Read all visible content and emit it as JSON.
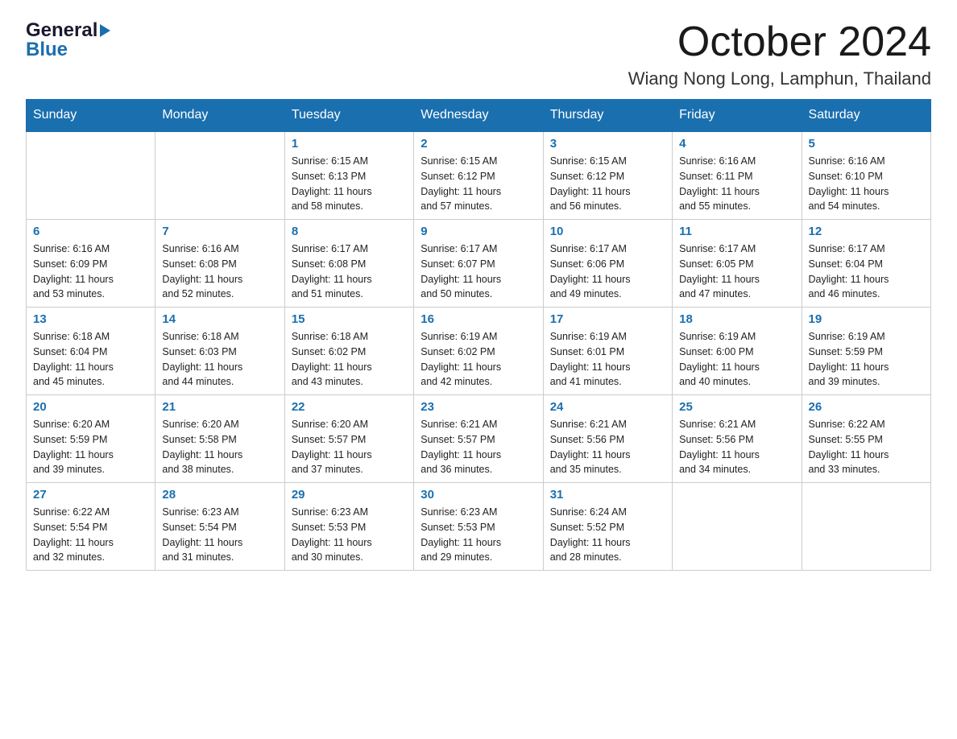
{
  "logo": {
    "line1": "General",
    "line2": "Blue"
  },
  "header": {
    "month": "October 2024",
    "location": "Wiang Nong Long, Lamphun, Thailand"
  },
  "weekdays": [
    "Sunday",
    "Monday",
    "Tuesday",
    "Wednesday",
    "Thursday",
    "Friday",
    "Saturday"
  ],
  "weeks": [
    [
      {
        "day": "",
        "info": ""
      },
      {
        "day": "",
        "info": ""
      },
      {
        "day": "1",
        "info": "Sunrise: 6:15 AM\nSunset: 6:13 PM\nDaylight: 11 hours\nand 58 minutes."
      },
      {
        "day": "2",
        "info": "Sunrise: 6:15 AM\nSunset: 6:12 PM\nDaylight: 11 hours\nand 57 minutes."
      },
      {
        "day": "3",
        "info": "Sunrise: 6:15 AM\nSunset: 6:12 PM\nDaylight: 11 hours\nand 56 minutes."
      },
      {
        "day": "4",
        "info": "Sunrise: 6:16 AM\nSunset: 6:11 PM\nDaylight: 11 hours\nand 55 minutes."
      },
      {
        "day": "5",
        "info": "Sunrise: 6:16 AM\nSunset: 6:10 PM\nDaylight: 11 hours\nand 54 minutes."
      }
    ],
    [
      {
        "day": "6",
        "info": "Sunrise: 6:16 AM\nSunset: 6:09 PM\nDaylight: 11 hours\nand 53 minutes."
      },
      {
        "day": "7",
        "info": "Sunrise: 6:16 AM\nSunset: 6:08 PM\nDaylight: 11 hours\nand 52 minutes."
      },
      {
        "day": "8",
        "info": "Sunrise: 6:17 AM\nSunset: 6:08 PM\nDaylight: 11 hours\nand 51 minutes."
      },
      {
        "day": "9",
        "info": "Sunrise: 6:17 AM\nSunset: 6:07 PM\nDaylight: 11 hours\nand 50 minutes."
      },
      {
        "day": "10",
        "info": "Sunrise: 6:17 AM\nSunset: 6:06 PM\nDaylight: 11 hours\nand 49 minutes."
      },
      {
        "day": "11",
        "info": "Sunrise: 6:17 AM\nSunset: 6:05 PM\nDaylight: 11 hours\nand 47 minutes."
      },
      {
        "day": "12",
        "info": "Sunrise: 6:17 AM\nSunset: 6:04 PM\nDaylight: 11 hours\nand 46 minutes."
      }
    ],
    [
      {
        "day": "13",
        "info": "Sunrise: 6:18 AM\nSunset: 6:04 PM\nDaylight: 11 hours\nand 45 minutes."
      },
      {
        "day": "14",
        "info": "Sunrise: 6:18 AM\nSunset: 6:03 PM\nDaylight: 11 hours\nand 44 minutes."
      },
      {
        "day": "15",
        "info": "Sunrise: 6:18 AM\nSunset: 6:02 PM\nDaylight: 11 hours\nand 43 minutes."
      },
      {
        "day": "16",
        "info": "Sunrise: 6:19 AM\nSunset: 6:02 PM\nDaylight: 11 hours\nand 42 minutes."
      },
      {
        "day": "17",
        "info": "Sunrise: 6:19 AM\nSunset: 6:01 PM\nDaylight: 11 hours\nand 41 minutes."
      },
      {
        "day": "18",
        "info": "Sunrise: 6:19 AM\nSunset: 6:00 PM\nDaylight: 11 hours\nand 40 minutes."
      },
      {
        "day": "19",
        "info": "Sunrise: 6:19 AM\nSunset: 5:59 PM\nDaylight: 11 hours\nand 39 minutes."
      }
    ],
    [
      {
        "day": "20",
        "info": "Sunrise: 6:20 AM\nSunset: 5:59 PM\nDaylight: 11 hours\nand 39 minutes."
      },
      {
        "day": "21",
        "info": "Sunrise: 6:20 AM\nSunset: 5:58 PM\nDaylight: 11 hours\nand 38 minutes."
      },
      {
        "day": "22",
        "info": "Sunrise: 6:20 AM\nSunset: 5:57 PM\nDaylight: 11 hours\nand 37 minutes."
      },
      {
        "day": "23",
        "info": "Sunrise: 6:21 AM\nSunset: 5:57 PM\nDaylight: 11 hours\nand 36 minutes."
      },
      {
        "day": "24",
        "info": "Sunrise: 6:21 AM\nSunset: 5:56 PM\nDaylight: 11 hours\nand 35 minutes."
      },
      {
        "day": "25",
        "info": "Sunrise: 6:21 AM\nSunset: 5:56 PM\nDaylight: 11 hours\nand 34 minutes."
      },
      {
        "day": "26",
        "info": "Sunrise: 6:22 AM\nSunset: 5:55 PM\nDaylight: 11 hours\nand 33 minutes."
      }
    ],
    [
      {
        "day": "27",
        "info": "Sunrise: 6:22 AM\nSunset: 5:54 PM\nDaylight: 11 hours\nand 32 minutes."
      },
      {
        "day": "28",
        "info": "Sunrise: 6:23 AM\nSunset: 5:54 PM\nDaylight: 11 hours\nand 31 minutes."
      },
      {
        "day": "29",
        "info": "Sunrise: 6:23 AM\nSunset: 5:53 PM\nDaylight: 11 hours\nand 30 minutes."
      },
      {
        "day": "30",
        "info": "Sunrise: 6:23 AM\nSunset: 5:53 PM\nDaylight: 11 hours\nand 29 minutes."
      },
      {
        "day": "31",
        "info": "Sunrise: 6:24 AM\nSunset: 5:52 PM\nDaylight: 11 hours\nand 28 minutes."
      },
      {
        "day": "",
        "info": ""
      },
      {
        "day": "",
        "info": ""
      }
    ]
  ]
}
